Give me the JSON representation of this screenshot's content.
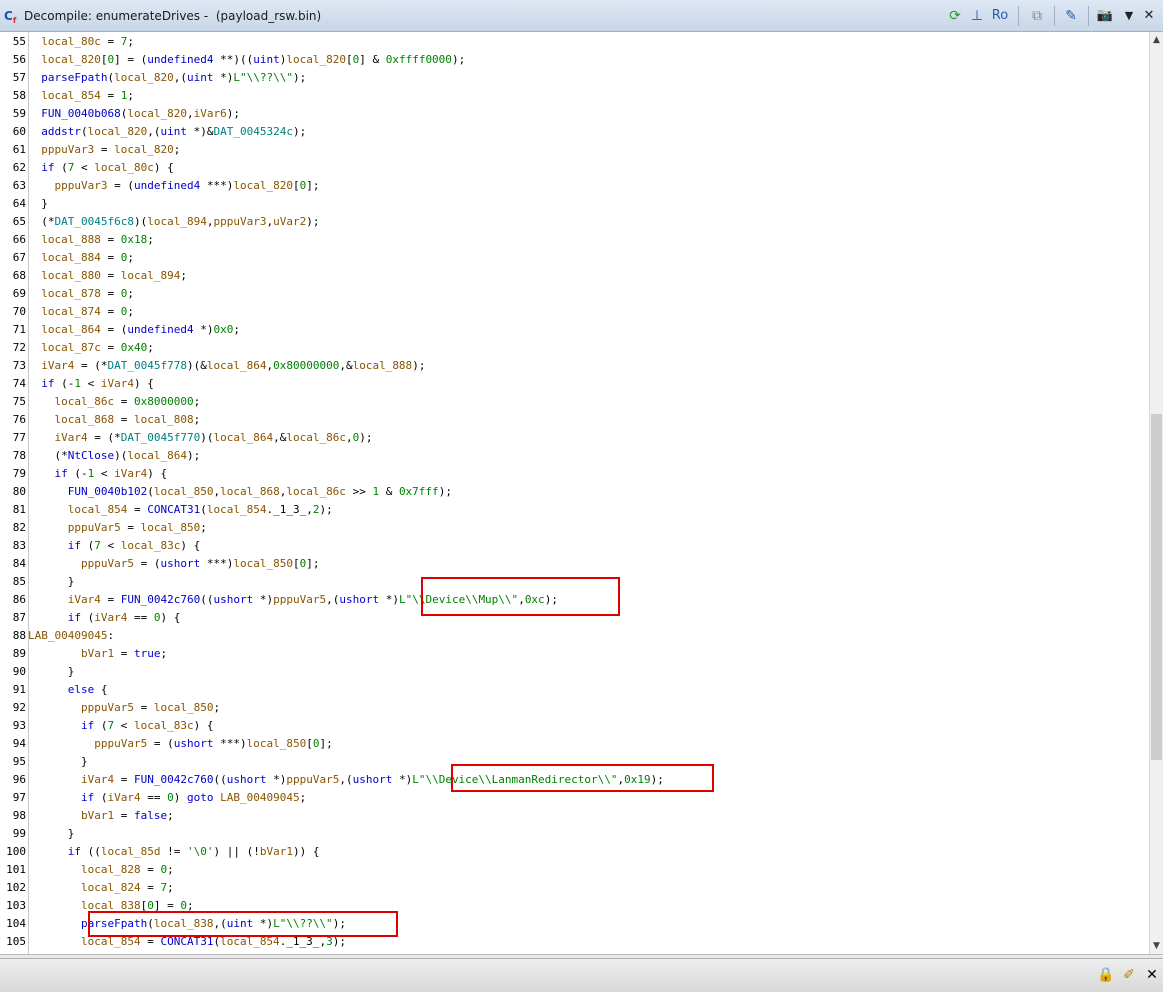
{
  "window": {
    "title": "Decompile: enumerateDrives -  (payload_rsw.bin)",
    "icon_label": "C",
    "icon_sub": "f"
  },
  "toolbar": {
    "refresh_icon": "⟳",
    "graph_icon": "⊥",
    "ro_label": "Ro",
    "copy_icon": "⧉",
    "edit_icon": "✎",
    "snapshot_icon": "📷",
    "menu_icon": "▼",
    "close_icon": "✕"
  },
  "colors": {
    "keyword": "#0000cc",
    "string": "#008000",
    "highlight": "#e00000"
  },
  "code_lines": [
    {
      "n": "55",
      "t": "  local_80c = 7;"
    },
    {
      "n": "56",
      "t": "  local_820[0] = (undefined4 **)((uint)local_820[0] & 0xffff0000);"
    },
    {
      "n": "57",
      "t": "  parseFpath(local_820,(uint *)L\"\\\\??\\\\\");"
    },
    {
      "n": "58",
      "t": "  local_854 = 1;"
    },
    {
      "n": "59",
      "t": "  FUN_0040b068(local_820,iVar6);"
    },
    {
      "n": "60",
      "t": "  addstr(local_820,(uint *)&DAT_0045324c);"
    },
    {
      "n": "61",
      "t": "  pppuVar3 = local_820;"
    },
    {
      "n": "62",
      "t": "  if (7 < local_80c) {"
    },
    {
      "n": "63",
      "t": "    pppuVar3 = (undefined4 ***)local_820[0];"
    },
    {
      "n": "64",
      "t": "  }"
    },
    {
      "n": "65",
      "t": "  (*DAT_0045f6c8)(local_894,pppuVar3,uVar2);"
    },
    {
      "n": "66",
      "t": "  local_888 = 0x18;"
    },
    {
      "n": "67",
      "t": "  local_884 = 0;"
    },
    {
      "n": "68",
      "t": "  local_880 = local_894;"
    },
    {
      "n": "69",
      "t": "  local_878 = 0;"
    },
    {
      "n": "70",
      "t": "  local_874 = 0;"
    },
    {
      "n": "71",
      "t": "  local_864 = (undefined4 *)0x0;"
    },
    {
      "n": "72",
      "t": "  local_87c = 0x40;"
    },
    {
      "n": "73",
      "t": "  iVar4 = (*DAT_0045f778)(&local_864,0x80000000,&local_888);"
    },
    {
      "n": "74",
      "t": "  if (-1 < iVar4) {"
    },
    {
      "n": "75",
      "t": "    local_86c = 0x8000000;"
    },
    {
      "n": "76",
      "t": "    local_868 = local_808;"
    },
    {
      "n": "77",
      "t": "    iVar4 = (*DAT_0045f770)(local_864,&local_86c,0);"
    },
    {
      "n": "78",
      "t": "    (*NtClose)(local_864);"
    },
    {
      "n": "79",
      "t": "    if (-1 < iVar4) {"
    },
    {
      "n": "80",
      "t": "      FUN_0040b102(local_850,local_868,local_86c >> 1 & 0x7fff);"
    },
    {
      "n": "81",
      "t": "      local_854 = CONCAT31(local_854._1_3_,2);"
    },
    {
      "n": "82",
      "t": "      pppuVar5 = local_850;"
    },
    {
      "n": "83",
      "t": "      if (7 < local_83c) {"
    },
    {
      "n": "84",
      "t": "        pppuVar5 = (ushort ***)local_850[0];"
    },
    {
      "n": "85",
      "t": "      }"
    },
    {
      "n": "86",
      "t": "      iVar4 = FUN_0042c760((ushort *)pppuVar5,(ushort *)L\"\\\\Device\\\\Mup\\\\\",0xc);"
    },
    {
      "n": "87",
      "t": "      if (iVar4 == 0) {"
    },
    {
      "n": "88",
      "t": "LAB_00409045:"
    },
    {
      "n": "89",
      "t": "        bVar1 = true;"
    },
    {
      "n": "90",
      "t": "      }"
    },
    {
      "n": "91",
      "t": "      else {"
    },
    {
      "n": "92",
      "t": "        pppuVar5 = local_850;"
    },
    {
      "n": "93",
      "t": "        if (7 < local_83c) {"
    },
    {
      "n": "94",
      "t": "          pppuVar5 = (ushort ***)local_850[0];"
    },
    {
      "n": "95",
      "t": "        }"
    },
    {
      "n": "96",
      "t": "        iVar4 = FUN_0042c760((ushort *)pppuVar5,(ushort *)L\"\\\\Device\\\\LanmanRedirector\\\\\",0x19);"
    },
    {
      "n": "97",
      "t": "        if (iVar4 == 0) goto LAB_00409045;"
    },
    {
      "n": "98",
      "t": "        bVar1 = false;"
    },
    {
      "n": "99",
      "t": "      }"
    },
    {
      "n": "100",
      "t": "      if ((local_85d != '\\0') || (!bVar1)) {"
    },
    {
      "n": "101",
      "t": "        local_828 = 0;"
    },
    {
      "n": "102",
      "t": "        local_824 = 7;"
    },
    {
      "n": "103",
      "t": "        local_838[0] = 0;"
    },
    {
      "n": "104",
      "t": "        parseFpath(local_838,(uint *)L\"\\\\??\\\\\");"
    },
    {
      "n": "105",
      "t": "        local_854 = CONCAT31(local_854._1_3_,3);"
    }
  ],
  "bottombar": {
    "lock_icon": "🔒",
    "eraser_icon": "✐",
    "close_icon": "✕"
  }
}
